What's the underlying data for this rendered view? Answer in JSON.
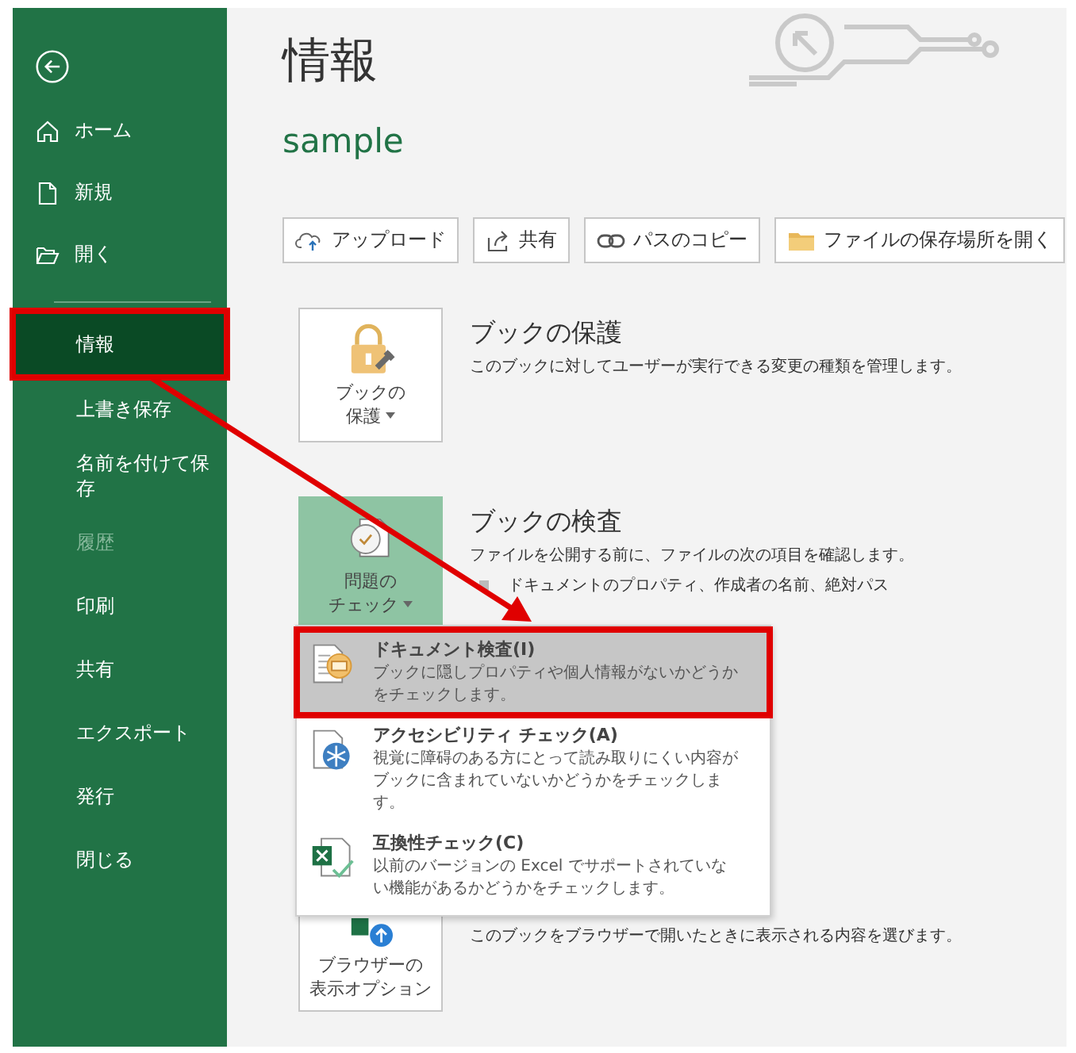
{
  "sidebar": {
    "top_items": [
      {
        "label": "ホーム"
      },
      {
        "label": "新規"
      },
      {
        "label": "開く"
      }
    ],
    "items": [
      {
        "label": "情報",
        "selected": true,
        "disabled": false,
        "annotated": true
      },
      {
        "label": "上書き保存",
        "selected": false,
        "disabled": false,
        "annotated": false
      },
      {
        "label": "名前を付けて保存",
        "selected": false,
        "disabled": false,
        "annotated": false
      },
      {
        "label": "履歴",
        "selected": false,
        "disabled": true,
        "annotated": false
      },
      {
        "label": "印刷",
        "selected": false,
        "disabled": false,
        "annotated": false
      },
      {
        "label": "共有",
        "selected": false,
        "disabled": false,
        "annotated": false
      },
      {
        "label": "エクスポート",
        "selected": false,
        "disabled": false,
        "annotated": false
      },
      {
        "label": "発行",
        "selected": false,
        "disabled": false,
        "annotated": false
      },
      {
        "label": "閉じる",
        "selected": false,
        "disabled": false,
        "annotated": false
      }
    ]
  },
  "title": "情報",
  "filename": "sample",
  "actions": [
    {
      "label": "アップロード"
    },
    {
      "label": "共有"
    },
    {
      "label": "パスのコピー"
    },
    {
      "label": "ファイルの保存場所を開く"
    }
  ],
  "sections": [
    {
      "button_lines": [
        "ブックの",
        "保護"
      ],
      "selected": false,
      "title": "ブックの保護",
      "description": "このブックに対してユーザーが実行できる変更の種類を管理します。"
    },
    {
      "button_lines": [
        "問題の",
        "チェック"
      ],
      "selected": true,
      "title": "ブックの検査",
      "description": "ファイルを公開する前に、ファイルの次の項目を確認します。",
      "bullets": [
        "ドキュメントのプロパティ、作成者の名前、絶対パス"
      ]
    },
    {
      "button_lines": [
        "ブラウザーの",
        "表示オプション"
      ],
      "selected": false,
      "description": "このブックをブラウザーで開いたときに表示される内容を選びます。"
    }
  ],
  "menu": {
    "items": [
      {
        "title": "ドキュメント検査(I)",
        "description": "ブックに隠しプロパティや個人情報がないかどうかをチェックします。",
        "selected": true,
        "annotated": true
      },
      {
        "title": "アクセシビリティ チェック(A)",
        "description": "視覚に障碍のある方にとって読み取りにくい内容がブックに含まれていないかどうかをチェックします。",
        "selected": false,
        "annotated": false
      },
      {
        "title": "互換性チェック(C)",
        "description": "以前のバージョンの Excel でサポートされていない機能があるかどうかをチェックします。",
        "selected": false,
        "annotated": false
      }
    ]
  }
}
